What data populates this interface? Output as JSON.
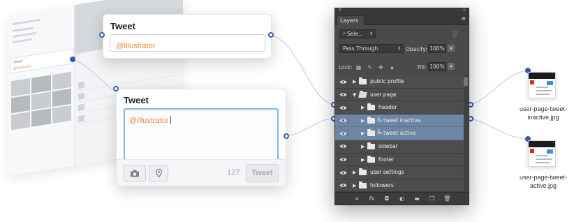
{
  "tweet_card_small": {
    "title": "Tweet",
    "value": "@Illustrator"
  },
  "tweet_card_large": {
    "title": "Tweet",
    "value": "@Illustrator",
    "char_count": "127",
    "submit_label": "Tweet"
  },
  "layers_panel": {
    "tab": "Layers",
    "search_placeholder": "Sele...",
    "blend_mode": "Pass Through",
    "opacity_label": "Opacity:",
    "opacity_value": "100%",
    "lock_label": "Lock:",
    "fill_label": "Fill:",
    "fill_value": "100%",
    "layers": [
      {
        "name": "public profile",
        "indent": 0,
        "expanded": false,
        "selected": false,
        "linked": false
      },
      {
        "name": "user page",
        "indent": 0,
        "expanded": true,
        "selected": false,
        "linked": false
      },
      {
        "name": "header",
        "indent": 1,
        "expanded": false,
        "selected": false,
        "linked": false
      },
      {
        "name": "tweet inactive",
        "indent": 1,
        "expanded": false,
        "selected": true,
        "linked": true
      },
      {
        "name": "tweet active",
        "indent": 1,
        "expanded": false,
        "selected": true,
        "linked": true
      },
      {
        "name": "sidebar",
        "indent": 1,
        "expanded": false,
        "selected": false,
        "linked": false
      },
      {
        "name": "footer",
        "indent": 1,
        "expanded": false,
        "selected": false,
        "linked": false
      },
      {
        "name": "user settings",
        "indent": 0,
        "expanded": false,
        "selected": false,
        "linked": false
      },
      {
        "name": "followers",
        "indent": 0,
        "expanded": false,
        "selected": false,
        "linked": false
      }
    ]
  },
  "exports": [
    {
      "line1": "user-page-tweet-",
      "line2": "inactive.jpg"
    },
    {
      "line1": "user-page-tweet-",
      "line2": "active.jpg"
    }
  ],
  "mockup": {
    "menu_item_1": "Tweet",
    "menu_item_2": "@Illustrator"
  }
}
